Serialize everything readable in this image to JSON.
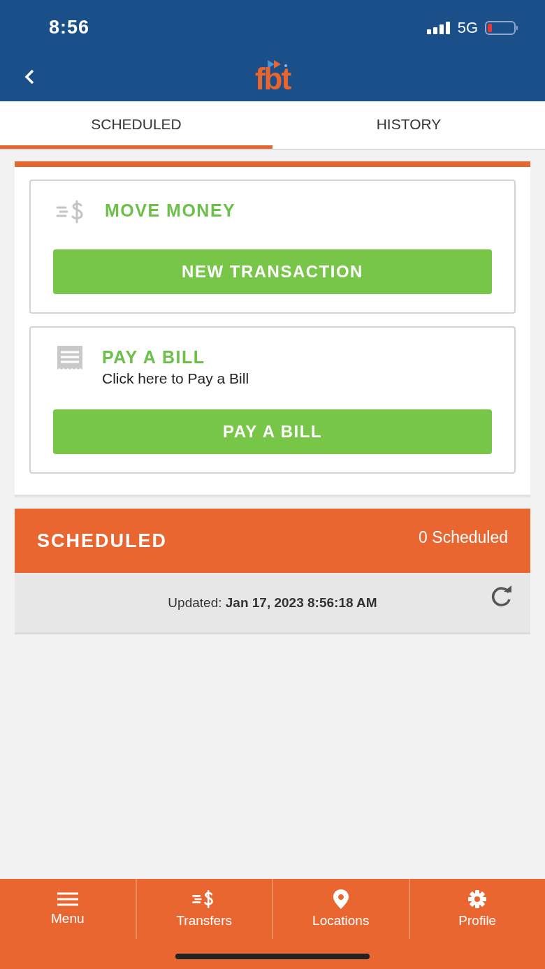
{
  "status_bar": {
    "time": "8:56",
    "network": "5G"
  },
  "header": {
    "logo": "fbt"
  },
  "tabs": [
    {
      "label": "SCHEDULED",
      "selected": true
    },
    {
      "label": "HISTORY",
      "selected": false
    }
  ],
  "cards": [
    {
      "kind": "move",
      "title": "MOVE MONEY",
      "button": "NEW TRANSACTION"
    },
    {
      "kind": "bill",
      "title": "PAY A BILL",
      "subtitle": "Click here to Pay a Bill",
      "button": "PAY A BILL"
    }
  ],
  "scheduled": {
    "title": "SCHEDULED",
    "count": "0 Scheduled",
    "updated": "Updated: **Jan 17, 2023 8:56:18 AM**"
  },
  "bottom_nav": [
    {
      "kind": "menu",
      "label": "Menu"
    },
    {
      "kind": "transfers",
      "label": "Transfers"
    },
    {
      "kind": "locations",
      "label": "Locations"
    },
    {
      "kind": "profile",
      "label": "Profile"
    }
  ]
}
